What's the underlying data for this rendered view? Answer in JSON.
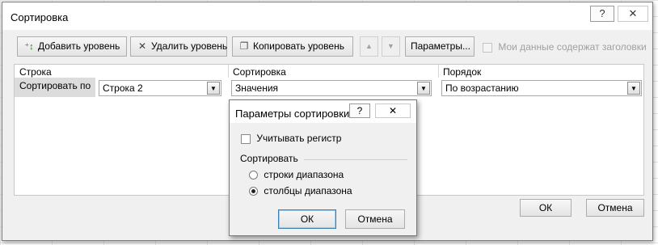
{
  "window": {
    "title": "Сортировка",
    "help_glyph": "?",
    "close_glyph": "✕"
  },
  "toolbar": {
    "add_level": {
      "icon": "add-level-icon",
      "glyph": "⁺↕",
      "label": "Добавить уровень"
    },
    "delete_level": {
      "icon": "delete-x-icon",
      "glyph": "✕",
      "label": "Удалить уровень"
    },
    "copy_level": {
      "icon": "copy-icon",
      "glyph": "❐",
      "label": "Копировать уровень"
    },
    "move_up_glyph": "▲",
    "move_down_glyph": "▼",
    "options_label": "Параметры...",
    "headers_checkbox_label": "Мои данные содержат заголовки"
  },
  "columns": {
    "row_header": "Строка",
    "sort_header": "Сортировка",
    "order_header": "Порядок"
  },
  "sort_row": {
    "label": "Сортировать по",
    "row_value": "Строка 2",
    "sort_on_value": "Значения",
    "order_value": "По возрастанию",
    "dropdown_glyph": "▼"
  },
  "footer": {
    "ok_label": "ОК",
    "cancel_label": "Отмена"
  },
  "options_dialog": {
    "title": "Параметры сортировки",
    "help_glyph": "?",
    "close_glyph": "✕",
    "case_sensitive_label": "Учитывать регистр",
    "case_sensitive_checked": false,
    "orientation_group_label": "Сортировать",
    "options": [
      {
        "label": "строки диапазона",
        "selected": false
      },
      {
        "label": "столбцы диапазона",
        "selected": true
      }
    ],
    "ok_label": "ОК",
    "cancel_label": "Отмена"
  },
  "colors": {
    "dialog_bg": "#f0f0f0",
    "titlebar_bg": "#ffffff",
    "border": "#7a7a7a",
    "disabled_text": "#a0a0a0",
    "default_button_border": "#3c7fb1"
  }
}
